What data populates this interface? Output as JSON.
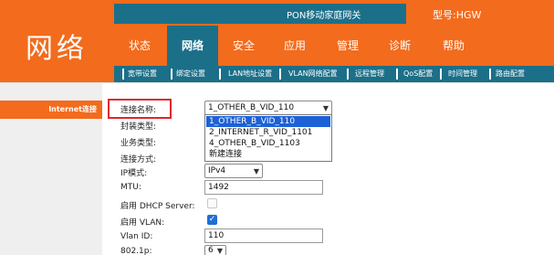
{
  "header": {
    "logo": "网络",
    "top_title": "PON移动家庭网关",
    "model": "型号:HGW"
  },
  "nav": {
    "items": [
      "状态",
      "网络",
      "安全",
      "应用",
      "管理",
      "诊断",
      "帮助"
    ],
    "active": "网络"
  },
  "subnav": {
    "items": [
      "宽带设置",
      "绑定设置",
      "LAN地址设置",
      "VLAN网络配置",
      "远程管理",
      "QoS配置",
      "时间管理",
      "路由配置"
    ]
  },
  "sidebar": {
    "items": [
      "Internet连接"
    ]
  },
  "form": {
    "labels": {
      "connection_name": "连接名称:",
      "encapsulation": "封装类型:",
      "service_type": "业务类型:",
      "connection_mode": "连接方式:",
      "ip_mode": "IP模式:",
      "mtu": "MTU:",
      "dhcp_server": "启用 DHCP Server:",
      "vlan": "启用 VLAN:",
      "vlan_id": "Vlan ID:",
      "dot1p": "802.1p:"
    },
    "connection_name_value": "1_OTHER_B_VID_110",
    "ip_mode_value": "IPv4",
    "mtu_value": "1492",
    "vlan_id_value": "110",
    "dot1p_value": "6",
    "dhcp_server_checked": false,
    "vlan_checked": true,
    "dropdown_options": [
      "1_OTHER_B_VID_110",
      "2_INTERNET_R_VID_1101",
      "4_OTHER_B_VID_1103",
      "新建连接"
    ],
    "dropdown_selected_index": 0
  },
  "icons": {
    "select_arrow": "chevron-down-icon",
    "checkbox_check": "check-icon"
  },
  "colors": {
    "brand_orange": "#f36b1c",
    "accent_teal": "#1c6f89",
    "highlight_red": "#e0262d",
    "selection_blue": "#1c61d6"
  }
}
